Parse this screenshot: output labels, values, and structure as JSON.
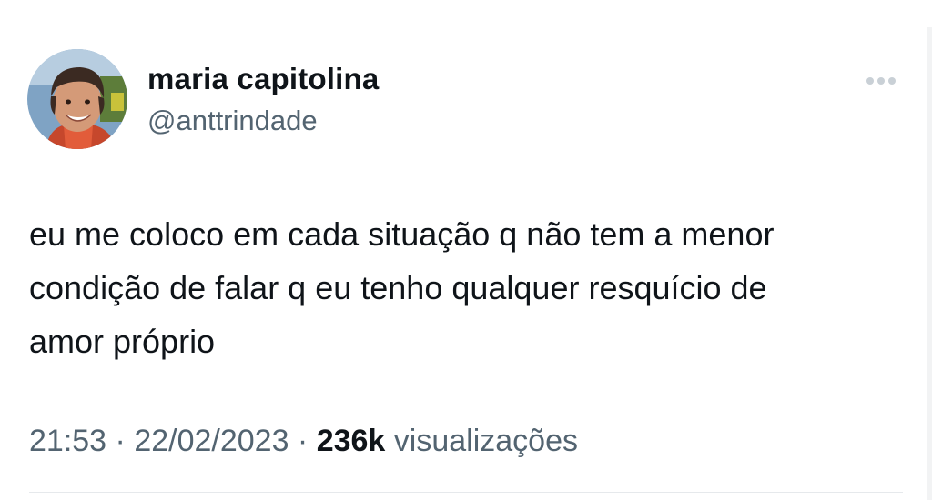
{
  "author": {
    "display_name": "maria capitolina",
    "handle": "@anttrindade",
    "avatar_icon": "profile-photo"
  },
  "more_icon": "more-horizontal-icon",
  "tweet": {
    "lines": [
      "eu me coloco em cada situação q não tem a menor",
      "condição de falar q eu tenho qualquer resquício de",
      "amor próprio"
    ]
  },
  "meta": {
    "time": "21:53",
    "separator": " · ",
    "date": "22/02/2023",
    "views_count": "236k",
    "views_label": " visualizações"
  },
  "colors": {
    "text": "#0f1419",
    "secondary": "#536471",
    "divider": "#e6e9ec"
  }
}
